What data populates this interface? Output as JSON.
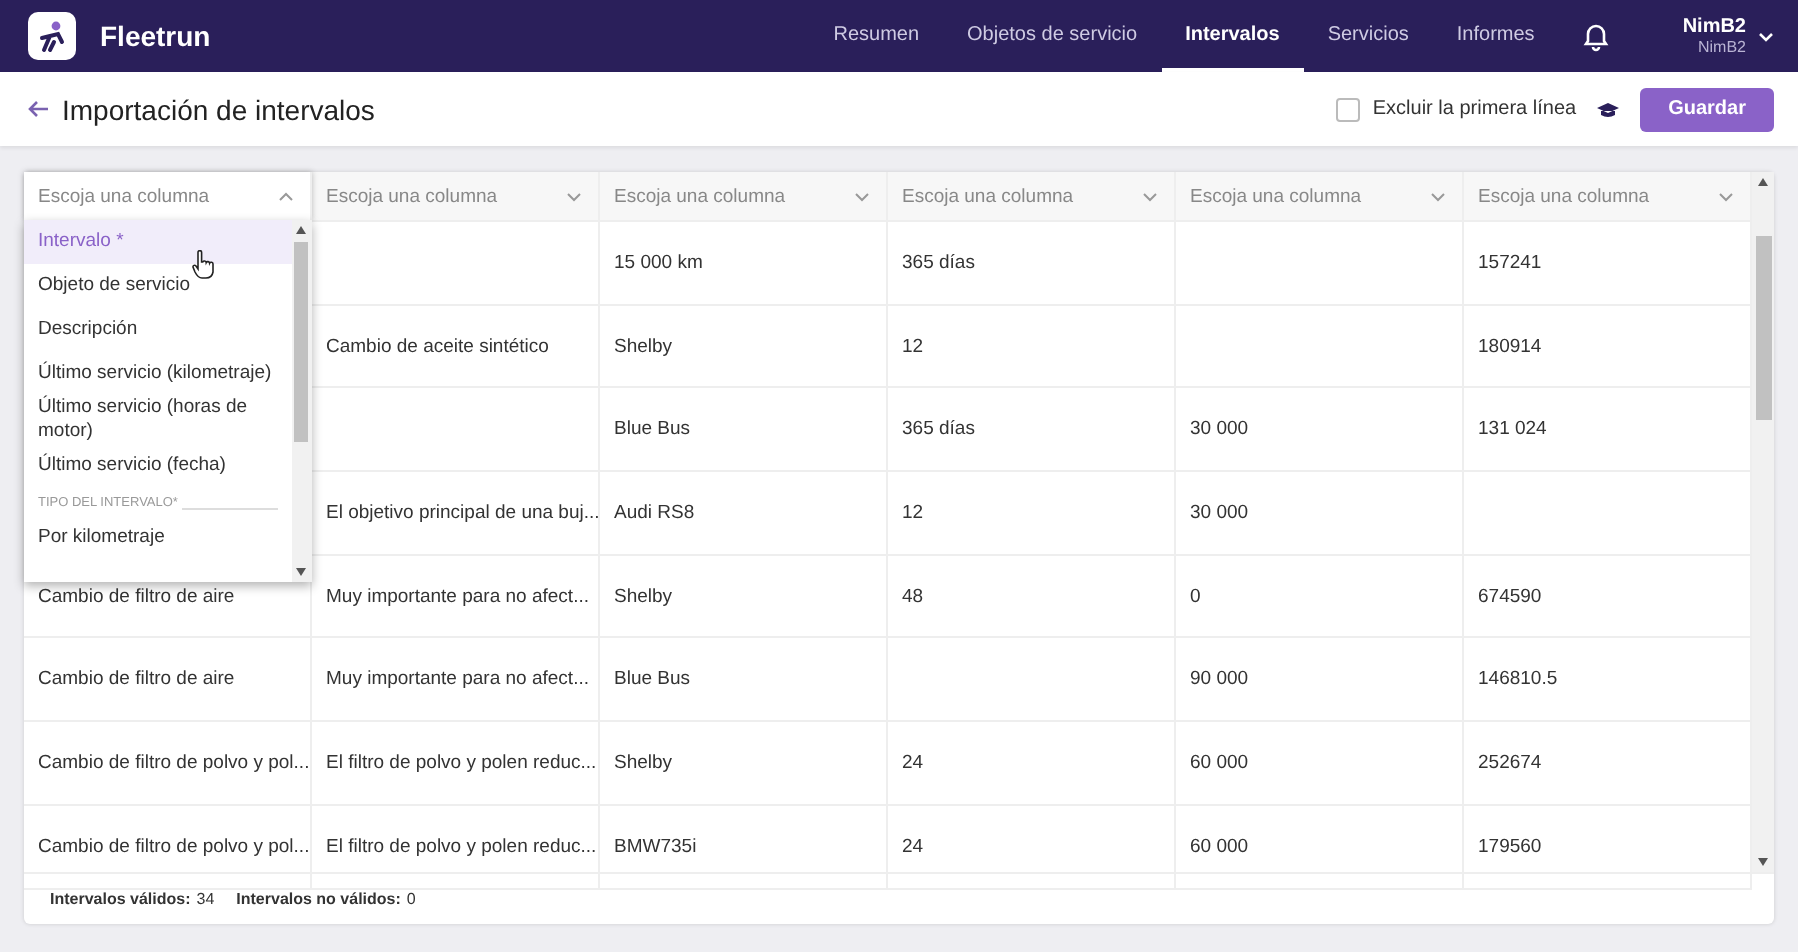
{
  "app": {
    "name": "Fleetrun"
  },
  "nav": [
    {
      "label": "Resumen",
      "selected": false
    },
    {
      "label": "Objetos de servicio",
      "selected": false
    },
    {
      "label": "Intervalos",
      "selected": true
    },
    {
      "label": "Servicios",
      "selected": false
    },
    {
      "label": "Informes",
      "selected": false
    }
  ],
  "user": {
    "name": "NimB2",
    "account": "NimB2"
  },
  "page": {
    "title": "Importación de intervalos",
    "exclude_first_line": {
      "label": "Excluir la primera línea",
      "checked": false
    },
    "save_button": "Guardar"
  },
  "table": {
    "columns": [
      {
        "placeholder": "Escoja una columna",
        "expanded": true
      },
      {
        "placeholder": "Escoja una columna",
        "expanded": false
      },
      {
        "placeholder": "Escoja una columna",
        "expanded": false
      },
      {
        "placeholder": "Escoja una columna",
        "expanded": false
      },
      {
        "placeholder": "Escoja una columna",
        "expanded": false
      },
      {
        "placeholder": "Escoja una columna",
        "expanded": false
      }
    ],
    "rows": [
      [
        null,
        null,
        "15 000 km",
        "365 días",
        null,
        "157241"
      ],
      [
        null,
        "Cambio de aceite sintético",
        "Shelby",
        "12",
        null,
        "180914"
      ],
      [
        null,
        null,
        "Blue Bus",
        "365 días",
        "30 000",
        "131 024"
      ],
      [
        null,
        "El objetivo principal de una buj...",
        "Audi RS8",
        "12",
        "30 000",
        null
      ],
      [
        "Cambio de filtro de aire",
        "Muy importante para no afect...",
        "Shelby",
        "48",
        "0",
        "674590"
      ],
      [
        "Cambio de filtro de aire",
        "Muy importante para no afect...",
        "Blue Bus",
        null,
        "90 000",
        "146810.5"
      ],
      [
        "Cambio de filtro de polvo y pol...",
        "El filtro de polvo y polen reduc...",
        "Shelby",
        "24",
        "60 000",
        "252674"
      ],
      [
        "Cambio de filtro de polvo y pol...",
        "El filtro de polvo y polen reduc...",
        "BMW735i",
        "24",
        "60 000",
        "179560"
      ]
    ]
  },
  "dropdown": {
    "items": [
      {
        "kind": "option",
        "label": "Intervalo *",
        "selected": true
      },
      {
        "kind": "option",
        "label": "Objeto de servicio",
        "selected": false
      },
      {
        "kind": "option",
        "label": "Descripción",
        "selected": false
      },
      {
        "kind": "option",
        "label": "Último servicio (kilometraje)",
        "selected": false
      },
      {
        "kind": "option",
        "label": "Último servicio (horas de motor)",
        "selected": false
      },
      {
        "kind": "option",
        "label": "Último servicio (fecha)",
        "selected": false
      },
      {
        "kind": "group",
        "label": "TIPO DEL INTERVALO*"
      },
      {
        "kind": "option",
        "label": "Por kilometraje",
        "selected": false
      }
    ]
  },
  "footer": [
    {
      "label": "Intervalos válidos:",
      "value": "34"
    },
    {
      "label": "Intervalos no válidos:",
      "value": "0"
    }
  ]
}
